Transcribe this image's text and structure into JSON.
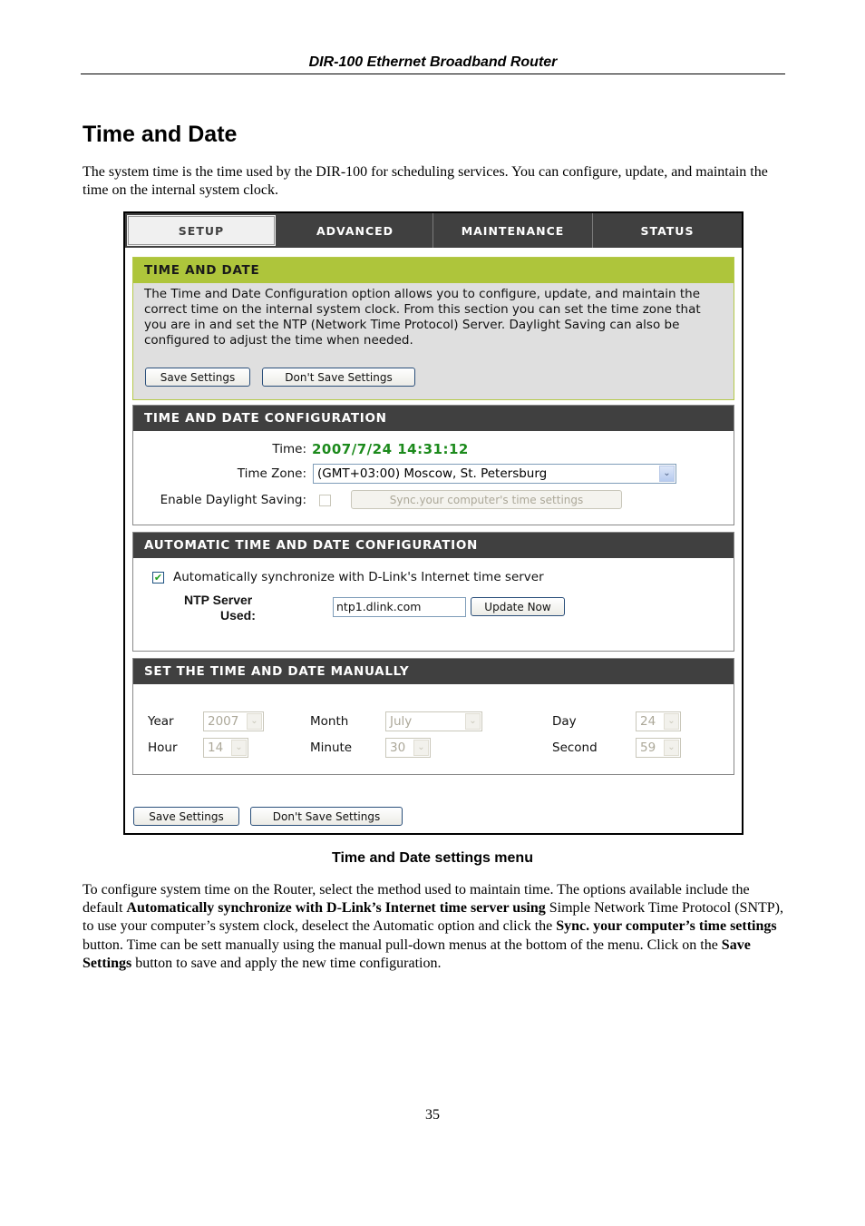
{
  "document": {
    "running_header": "DIR-100 Ethernet Broadband Router",
    "title": "Time and Date",
    "intro": "The system time is the time used by the DIR-100 for scheduling services. You can configure, update, and maintain the time on the internal system clock.",
    "caption": "Time and Date settings menu",
    "body_parts": {
      "p1": "To configure system time on the Router, select the method used to maintain time. The options available include the default ",
      "b1": "Automatically synchronize with D-Link’s Internet time server using",
      "p2": " Simple Network Time Protocol (SNTP), to use your computer’s system clock, deselect the Automatic option and click the ",
      "b2": "Sync. your computer’s time settings",
      "p3": " button. Time can be sett manually using the manual pull-down menus at the bottom of the menu. Click on the ",
      "b3": "Save Settings",
      "p4": " button to save and apply the new time configuration."
    },
    "page_number": "35"
  },
  "router_ui": {
    "tabs": [
      {
        "label": "SETUP",
        "active": true
      },
      {
        "label": "ADVANCED",
        "active": false
      },
      {
        "label": "MAINTENANCE",
        "active": false
      },
      {
        "label": "STATUS",
        "active": false
      }
    ],
    "intro_box": {
      "heading": "TIME AND DATE",
      "text": "The Time and Date Configuration option allows you to configure, update, and maintain the correct time on the internal system clock. From this section you can set the time zone that you are in and set the NTP (Network Time Protocol) Server. Daylight Saving can also be configured to adjust the time when needed.",
      "save_label": "Save Settings",
      "dont_save_label": "Don't Save Settings"
    },
    "config": {
      "heading": "TIME AND DATE CONFIGURATION",
      "time_label": "Time:",
      "time_value": "2007/7/24 14:31:12",
      "timezone_label": "Time Zone:",
      "timezone_value": "(GMT+03:00) Moscow, St. Petersburg",
      "daylight_label": "Enable Daylight Saving:",
      "daylight_checked": false,
      "sync_button_label": "Sync.your computer's time settings"
    },
    "auto": {
      "heading": "AUTOMATIC TIME AND DATE CONFIGURATION",
      "auto_sync_label": "Automatically synchronize with D-Link's Internet time server",
      "auto_sync_checked": true,
      "ntp_label_line1": "NTP Server",
      "ntp_label_line2": "Used:",
      "ntp_value": "ntp1.dlink.com",
      "update_label": "Update Now"
    },
    "manual": {
      "heading": "SET THE TIME AND DATE MANUALLY",
      "year_label": "Year",
      "year_value": "2007",
      "month_label": "Month",
      "month_value": "July",
      "day_label": "Day",
      "day_value": "24",
      "hour_label": "Hour",
      "hour_value": "14",
      "minute_label": "Minute",
      "minute_value": "30",
      "second_label": "Second",
      "second_value": "59"
    },
    "footer": {
      "save_label": "Save Settings",
      "dont_save_label": "Don't Save Settings"
    },
    "icons": {
      "dropdown_arrow": "⌄",
      "check": "✔"
    },
    "colors": {
      "tab_bar": "#404040",
      "intro_header": "#aec53b",
      "time_value": "#1c8a1c"
    }
  }
}
